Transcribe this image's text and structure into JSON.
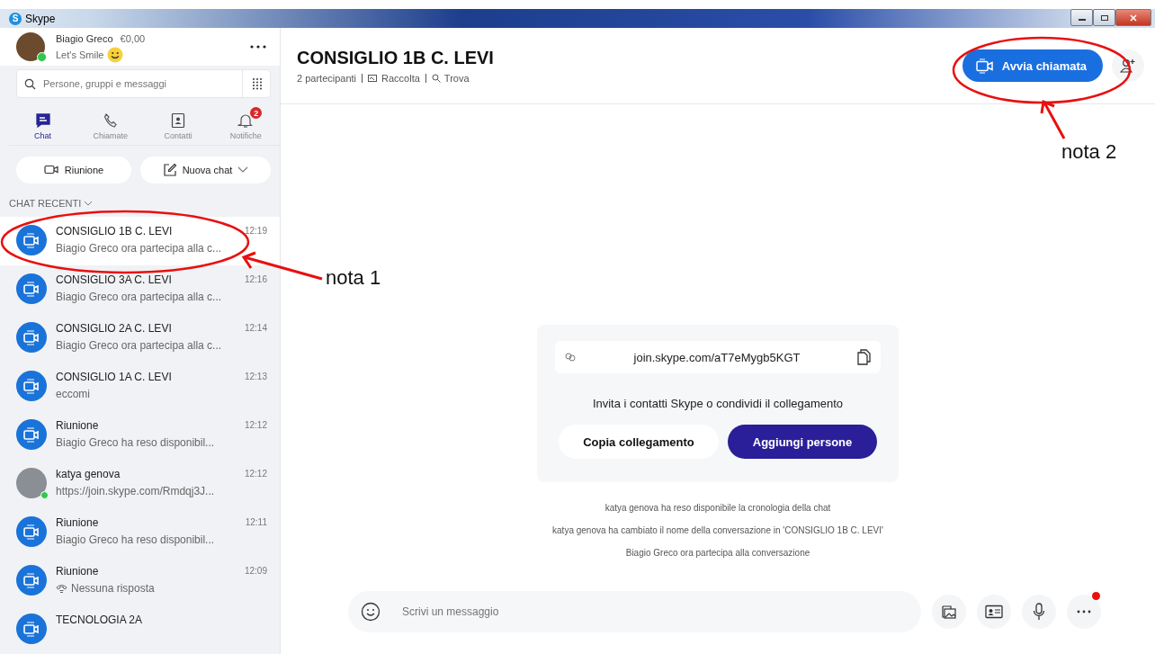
{
  "window": {
    "title": "Skype",
    "logo_letter": "S"
  },
  "profile": {
    "name": "Biagio Greco",
    "credit": "€0,00",
    "mood": "Let's Smile",
    "online": true
  },
  "search": {
    "placeholder": "Persone, gruppi e messaggi"
  },
  "nav_tabs": [
    {
      "label": "Chat",
      "kind": "chat",
      "selected": true
    },
    {
      "label": "Chiamate",
      "kind": "calls",
      "selected": false
    },
    {
      "label": "Contatti",
      "kind": "contacts",
      "selected": false
    },
    {
      "label": "Notifiche",
      "kind": "notifications",
      "selected": false,
      "badge": "2"
    }
  ],
  "actions": [
    {
      "label": "Riunione",
      "kind": "meeting"
    },
    {
      "label": "Nuova chat",
      "kind": "new-chat"
    }
  ],
  "recent_header": "CHAT RECENTI",
  "chats": [
    {
      "title": "CONSIGLIO 1B C. LEVI",
      "time": "12:19",
      "preview": "Biagio Greco ora partecipa alla c...",
      "kind": "group",
      "selected": true
    },
    {
      "title": "CONSIGLIO 3A C. LEVI",
      "time": "12:16",
      "preview": "Biagio Greco ora partecipa alla c...",
      "kind": "group",
      "selected": false
    },
    {
      "title": "CONSIGLIO 2A C. LEVI",
      "time": "12:14",
      "preview": "Biagio Greco ora partecipa alla c...",
      "kind": "group",
      "selected": false
    },
    {
      "title": "CONSIGLIO 1A C. LEVI",
      "time": "12:13",
      "preview": "eccomi",
      "kind": "group",
      "selected": false
    },
    {
      "title": "Riunione",
      "time": "12:12",
      "preview": "Biagio Greco ha reso disponibil...",
      "kind": "group",
      "selected": false
    },
    {
      "title": "katya genova",
      "time": "12:12",
      "preview": "https://join.skype.com/Rmdqj3J...",
      "kind": "person",
      "selected": false
    },
    {
      "title": "Riunione",
      "time": "12:11",
      "preview": "Biagio Greco ha reso disponibil...",
      "kind": "group",
      "selected": false
    },
    {
      "title": "Riunione",
      "time": "12:09",
      "preview": "Nessuna risposta",
      "missed_call": true,
      "kind": "group",
      "selected": false
    },
    {
      "title": "TECNOLOGIA 2A",
      "kind": "group",
      "selected": false
    }
  ],
  "conversation": {
    "title": "CONSIGLIO 1B C. LEVI",
    "participants": "2 partecipanti",
    "links": [
      {
        "label": "Raccolta",
        "kind": "gallery"
      },
      {
        "label": "Trova",
        "kind": "find"
      }
    ],
    "call_button": "Avvia chiamata"
  },
  "invite": {
    "link": "join.skype.com/aT7eMygb5KGT",
    "text": "Invita i contatti Skype o condividi il collegamento",
    "buttons": [
      {
        "label": "Copia collegamento",
        "kind": "secondary"
      },
      {
        "label": "Aggiungi persone",
        "kind": "primary"
      }
    ]
  },
  "events": [
    "katya genova ha reso disponibile la cronologia della chat",
    "katya genova ha cambiato il nome della conversazione in 'CONSIGLIO 1B C. LEVI'",
    "Biagio Greco ora partecipa alla conversazione"
  ],
  "composer": {
    "placeholder": "Scrivi un messaggio",
    "more_badge": true
  },
  "annotations": [
    {
      "label": "nota 1",
      "kind": "chat"
    },
    {
      "label": "nota 2",
      "kind": "call"
    }
  ]
}
